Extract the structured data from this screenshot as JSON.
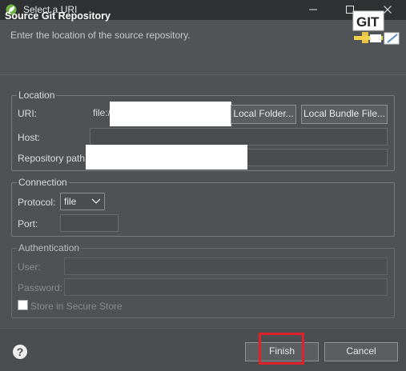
{
  "window": {
    "title": "Select a URI",
    "icon": "spring-leaf-icon",
    "controls": [
      "minimize",
      "maximize",
      "close"
    ]
  },
  "header": {
    "title": "Source Git Repository",
    "description": "Enter the location of the source repository.",
    "logo_text": "GIT"
  },
  "location": {
    "group_label": "Location",
    "uri_label": "URI:",
    "uri_prefix": "file:/",
    "local_folder_button": "Local Folder...",
    "local_bundle_button": "Local Bundle File...",
    "host_label": "Host:",
    "repository_path_label": "Repository path:"
  },
  "connection": {
    "group_label": "Connection",
    "protocol_label": "Protocol:",
    "protocol_value": "file",
    "port_label": "Port:"
  },
  "authentication": {
    "group_label": "Authentication",
    "user_label": "User:",
    "password_label": "Password:",
    "store_label": "Store in Secure Store"
  },
  "footer": {
    "finish_label": "Finish",
    "cancel_label": "Cancel"
  },
  "colors": {
    "highlight": "#e0232a",
    "background": "#4f5254",
    "titlebar": "#2f3133"
  }
}
